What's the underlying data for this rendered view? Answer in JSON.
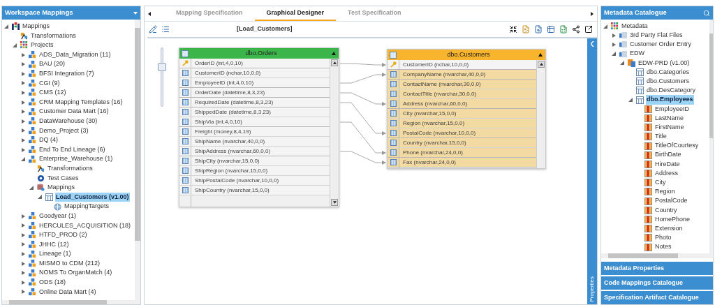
{
  "left_panel": {
    "title": "Workspace Mappings",
    "tree": [
      {
        "label": "Mappings",
        "kind": "mappings-root",
        "expanded": true,
        "selected": false,
        "children": [
          {
            "label": "Transformations",
            "kind": "transformations",
            "selected": false
          },
          {
            "label": "Projects",
            "kind": "projects",
            "expanded": true,
            "selected": false,
            "children": [
              {
                "label": "ADS_Data_Migration (11)",
                "kind": "project",
                "expanded": false,
                "selected": false
              },
              {
                "label": "BAU (20)",
                "kind": "project",
                "expanded": false,
                "selected": false
              },
              {
                "label": "BFSI Integration (7)",
                "kind": "project",
                "expanded": false,
                "selected": false
              },
              {
                "label": "CGI (9)",
                "kind": "project",
                "expanded": false,
                "selected": false
              },
              {
                "label": "CMS (12)",
                "kind": "project",
                "expanded": false,
                "selected": false
              },
              {
                "label": "CRM Mapping Templates (16)",
                "kind": "project",
                "expanded": false,
                "selected": false
              },
              {
                "label": "Customer Data Mart (16)",
                "kind": "project",
                "expanded": false,
                "selected": false
              },
              {
                "label": "DataWarehouse (30)",
                "kind": "project",
                "expanded": false,
                "selected": false
              },
              {
                "label": "Demo_Project (3)",
                "kind": "project",
                "expanded": false,
                "selected": false
              },
              {
                "label": "DQ (4)",
                "kind": "project",
                "expanded": false,
                "selected": false
              },
              {
                "label": "End To End Lineage (6)",
                "kind": "project",
                "expanded": false,
                "selected": false
              },
              {
                "label": "Enterprise_Warehouse (1)",
                "kind": "project",
                "expanded": true,
                "selected": false,
                "children": [
                  {
                    "label": "Transformations",
                    "kind": "transformations",
                    "selected": false
                  },
                  {
                    "label": "Test Cases",
                    "kind": "test-cases",
                    "selected": false
                  },
                  {
                    "label": "Mappings",
                    "kind": "mappings",
                    "expanded": true,
                    "selected": false,
                    "children": [
                      {
                        "label": "Load_Customers (v1.00)",
                        "kind": "mapping",
                        "expanded": true,
                        "selected": true,
                        "children": [
                          {
                            "label": "MappingTargets",
                            "kind": "targets",
                            "selected": false
                          }
                        ]
                      }
                    ]
                  }
                ]
              },
              {
                "label": "Goodyear (1)",
                "kind": "project",
                "expanded": false,
                "selected": false
              },
              {
                "label": "HERCULES_ACQUISITION (18)",
                "kind": "project",
                "expanded": false,
                "selected": false
              },
              {
                "label": "HTFD_PROD (2)",
                "kind": "project",
                "expanded": false,
                "selected": false
              },
              {
                "label": "JHHC (12)",
                "kind": "project",
                "expanded": false,
                "selected": false
              },
              {
                "label": "Lineage (1)",
                "kind": "project",
                "expanded": false,
                "selected": false
              },
              {
                "label": "MISMO to CDM (212)",
                "kind": "project",
                "expanded": false,
                "selected": false
              },
              {
                "label": "NOMS To OrganMatch (4)",
                "kind": "project",
                "expanded": false,
                "selected": false
              },
              {
                "label": "ODS (18)",
                "kind": "project",
                "expanded": false,
                "selected": false
              },
              {
                "label": "Online Data Mart (4)",
                "kind": "project",
                "expanded": false,
                "selected": false
              }
            ]
          }
        ]
      }
    ]
  },
  "center": {
    "tabs": [
      {
        "label": "Mapping Specification",
        "selected": false
      },
      {
        "label": "Graphical Designer",
        "selected": true
      },
      {
        "label": "Test Specification",
        "selected": false
      }
    ],
    "toolbar_title": "[Load_Customers]",
    "zoom_slider": {
      "level": 0.7
    },
    "source_table": {
      "name": "dbo.Orders",
      "rows": [
        {
          "label": "OrderID (int,4,0,10)",
          "kind": "key",
          "mapped": true
        },
        {
          "label": "CustomerID (nchar,10,0,0)",
          "kind": "column",
          "mapped": false
        },
        {
          "label": "EmployeeID (int,4,0,10)",
          "kind": "column",
          "mapped": true
        },
        {
          "label": "OrderDate (datetime,8,3,23)",
          "kind": "column",
          "mapped": true
        },
        {
          "label": "RequiredDate (datetime,8,3,23)",
          "kind": "column",
          "mapped": true
        },
        {
          "label": "ShippedDate (datetime,8,3,23)",
          "kind": "column",
          "mapped": false
        },
        {
          "label": "ShipVia (int,4,0,10)",
          "kind": "column",
          "mapped": true
        },
        {
          "label": "Freight (money,8,4,19)",
          "kind": "column",
          "mapped": false
        },
        {
          "label": "ShipName (nvarchar,40,0,0)",
          "kind": "column",
          "mapped": false
        },
        {
          "label": "ShipAddress (nvarchar,60,0,0)",
          "kind": "column",
          "mapped": true
        },
        {
          "label": "ShipCity (nvarchar,15,0,0)",
          "kind": "column",
          "mapped": false
        },
        {
          "label": "ShipRegion (nvarchar,15,0,0)",
          "kind": "column",
          "mapped": false
        },
        {
          "label": "ShipPostalCode (nvarchar,10,0,0)",
          "kind": "column",
          "mapped": false
        },
        {
          "label": "ShipCountry (nvarchar,15,0,0)",
          "kind": "column",
          "mapped": false
        }
      ]
    },
    "target_table": {
      "name": "dbo.Customers",
      "rows": [
        {
          "label": "CustomerID (nchar,10,0,0)",
          "kind": "key",
          "mapped": true,
          "highlighted": false
        },
        {
          "label": "CompanyName (nvarchar,40,0,0)",
          "kind": "column",
          "mapped": true,
          "highlighted": true
        },
        {
          "label": "ContactName (nvarchar,30,0,0)",
          "kind": "column",
          "mapped": false,
          "highlighted": true
        },
        {
          "label": "ContactTitle (nvarchar,30,0,0)",
          "kind": "column",
          "mapped": false,
          "highlighted": true
        },
        {
          "label": "Address (nvarchar,60,0,0)",
          "kind": "column",
          "mapped": true,
          "highlighted": true
        },
        {
          "label": "City (nvarchar,15,0,0)",
          "kind": "column",
          "mapped": false,
          "highlighted": true
        },
        {
          "label": "Region (nvarchar,15,0,0)",
          "kind": "column",
          "mapped": false,
          "highlighted": true
        },
        {
          "label": "PostalCode (nvarchar,10,0,0)",
          "kind": "column",
          "mapped": true,
          "highlighted": true
        },
        {
          "label": "Country (nvarchar,15,0,0)",
          "kind": "column",
          "mapped": false,
          "highlighted": true
        },
        {
          "label": "Phone (nvarchar,24,0,0)",
          "kind": "column",
          "mapped": true,
          "highlighted": true
        },
        {
          "label": "Fax (nvarchar,24,0,0)",
          "kind": "column",
          "mapped": true,
          "highlighted": true
        }
      ]
    },
    "side_tab": "Properties"
  },
  "right_panel": {
    "title": "Metadata Catalogue",
    "tree": [
      {
        "label": "Metadata",
        "kind": "metadata",
        "expanded": true,
        "selected": false,
        "children": [
          {
            "label": "3rd Party Flat Files",
            "kind": "system",
            "expanded": false,
            "selected": false
          },
          {
            "label": "Customer Order Entry",
            "kind": "system",
            "expanded": false,
            "selected": false
          },
          {
            "label": "EDW",
            "kind": "system",
            "expanded": true,
            "selected": false,
            "children": [
              {
                "label": "EDW-PRD (v1.00)",
                "kind": "environment",
                "expanded": true,
                "selected": false,
                "children": [
                  {
                    "label": "dbo.Categories",
                    "kind": "table",
                    "selected": false
                  },
                  {
                    "label": "dbo.Customers",
                    "kind": "table",
                    "selected": false
                  },
                  {
                    "label": "dbo.DesCategory",
                    "kind": "table",
                    "selected": false
                  },
                  {
                    "label": "dbo.Employees",
                    "kind": "table",
                    "expanded": true,
                    "selected": true,
                    "children": [
                      {
                        "label": "EmployeeID",
                        "kind": "column",
                        "selected": false
                      },
                      {
                        "label": "LastName",
                        "kind": "column",
                        "selected": false
                      },
                      {
                        "label": "FirstName",
                        "kind": "column",
                        "selected": false
                      },
                      {
                        "label": "Title",
                        "kind": "column",
                        "selected": false
                      },
                      {
                        "label": "TitleOfCourtesy",
                        "kind": "column",
                        "selected": false
                      },
                      {
                        "label": "BirthDate",
                        "kind": "column",
                        "selected": false
                      },
                      {
                        "label": "HireDate",
                        "kind": "column",
                        "selected": false
                      },
                      {
                        "label": "Address",
                        "kind": "column",
                        "selected": false
                      },
                      {
                        "label": "City",
                        "kind": "column",
                        "selected": false
                      },
                      {
                        "label": "Region",
                        "kind": "column",
                        "selected": false
                      },
                      {
                        "label": "PostalCode",
                        "kind": "column",
                        "selected": false
                      },
                      {
                        "label": "Country",
                        "kind": "column",
                        "selected": false
                      },
                      {
                        "label": "HomePhone",
                        "kind": "column",
                        "selected": false
                      },
                      {
                        "label": "Extension",
                        "kind": "column",
                        "selected": false
                      },
                      {
                        "label": "Photo",
                        "kind": "column",
                        "selected": false
                      },
                      {
                        "label": "Notes",
                        "kind": "column",
                        "selected": false
                      }
                    ]
                  }
                ]
              }
            ]
          }
        ]
      }
    ],
    "sections": [
      "Metadata Properties",
      "Code Mappings Catalogue",
      "Specification Artifact Catalogue"
    ]
  }
}
